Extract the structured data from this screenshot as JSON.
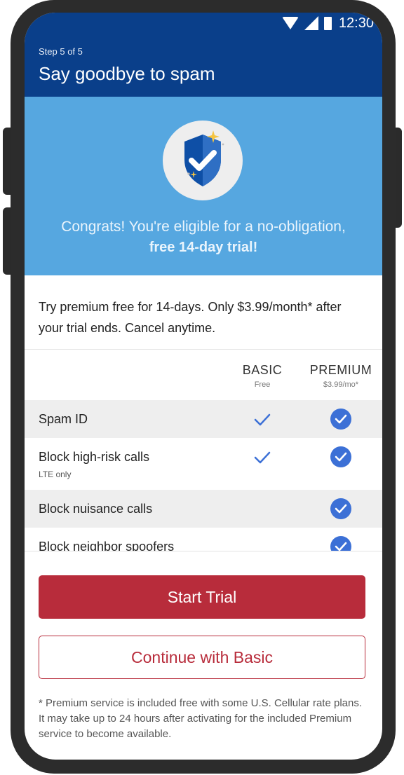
{
  "status_bar": {
    "time": "12:30",
    "icons": [
      "wifi-icon",
      "signal-icon",
      "battery-icon"
    ]
  },
  "header": {
    "step": "Step 5 of 5",
    "title": "Say goodbye to spam"
  },
  "hero": {
    "icon": "shield-check-icon",
    "line1": "Congrats! You're eligible for a no-obligation,",
    "line2": "free 14-day trial!"
  },
  "intro": "Try premium free for 14-days. Only $3.99/month* after your trial ends. Cancel anytime.",
  "plans": {
    "basic": {
      "name": "BASIC",
      "price": "Free"
    },
    "premium": {
      "name": "PREMIUM",
      "price": "$3.99/mo*"
    }
  },
  "features": [
    {
      "label": "Spam ID",
      "note": "",
      "basic": true,
      "premium": true
    },
    {
      "label": "Block high-risk calls",
      "note": "LTE only",
      "basic": true,
      "premium": true
    },
    {
      "label": "Block nuisance calls",
      "note": "",
      "basic": false,
      "premium": true
    },
    {
      "label": "Block neighbor spoofers",
      "note": "",
      "basic": false,
      "premium": true
    }
  ],
  "actions": {
    "start_trial": "Start Trial",
    "continue_basic": "Continue with Basic"
  },
  "footnote": "* Premium service is included free with some U.S. Cellular rate plans. It may take up to 24 hours after activating for the included Premium service to become available.",
  "colors": {
    "header_blue": "#0a3f8a",
    "hero_blue": "#56a7e0",
    "accent_red": "#b82c3b",
    "check_blue": "#3c70d6"
  }
}
